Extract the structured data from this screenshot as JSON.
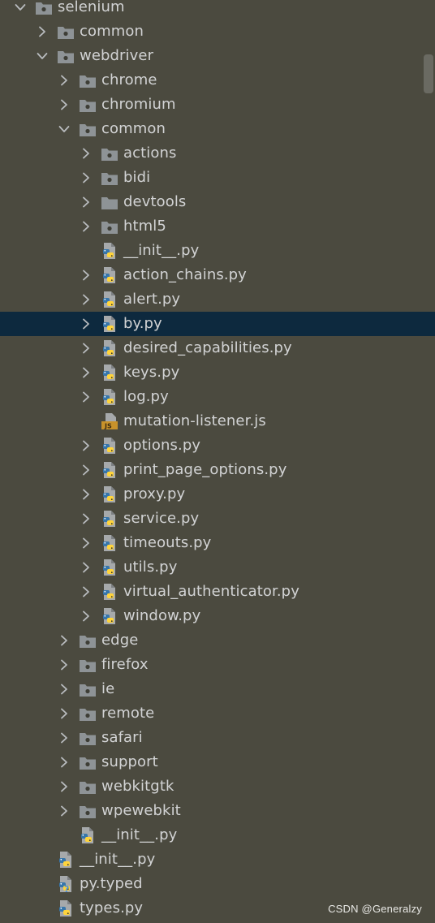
{
  "colors": {
    "background": "#4b4a3f",
    "selected_row": "#0d293e",
    "folder_icon": "#8e9396",
    "text": "#d2d3d4"
  },
  "tree": [
    {
      "label": "selenium",
      "depth": 0,
      "kind": "package",
      "arrow": "down"
    },
    {
      "label": "common",
      "depth": 1,
      "kind": "package",
      "arrow": "right"
    },
    {
      "label": "webdriver",
      "depth": 1,
      "kind": "package",
      "arrow": "down"
    },
    {
      "label": "chrome",
      "depth": 2,
      "kind": "package",
      "arrow": "right"
    },
    {
      "label": "chromium",
      "depth": 2,
      "kind": "package",
      "arrow": "right"
    },
    {
      "label": "common",
      "depth": 2,
      "kind": "package",
      "arrow": "down"
    },
    {
      "label": "actions",
      "depth": 3,
      "kind": "package",
      "arrow": "right"
    },
    {
      "label": "bidi",
      "depth": 3,
      "kind": "package",
      "arrow": "right"
    },
    {
      "label": "devtools",
      "depth": 3,
      "kind": "folder",
      "arrow": "right"
    },
    {
      "label": "html5",
      "depth": 3,
      "kind": "package",
      "arrow": "right"
    },
    {
      "label": "__init__.py",
      "depth": 3,
      "kind": "python",
      "arrow": "none"
    },
    {
      "label": "action_chains.py",
      "depth": 3,
      "kind": "python",
      "arrow": "right"
    },
    {
      "label": "alert.py",
      "depth": 3,
      "kind": "python",
      "arrow": "right"
    },
    {
      "label": "by.py",
      "depth": 3,
      "kind": "python",
      "arrow": "right",
      "selected": true
    },
    {
      "label": "desired_capabilities.py",
      "depth": 3,
      "kind": "python",
      "arrow": "right"
    },
    {
      "label": "keys.py",
      "depth": 3,
      "kind": "python",
      "arrow": "right"
    },
    {
      "label": "log.py",
      "depth": 3,
      "kind": "python",
      "arrow": "right"
    },
    {
      "label": "mutation-listener.js",
      "depth": 3,
      "kind": "js",
      "arrow": "none"
    },
    {
      "label": "options.py",
      "depth": 3,
      "kind": "python",
      "arrow": "right"
    },
    {
      "label": "print_page_options.py",
      "depth": 3,
      "kind": "python",
      "arrow": "right"
    },
    {
      "label": "proxy.py",
      "depth": 3,
      "kind": "python",
      "arrow": "right"
    },
    {
      "label": "service.py",
      "depth": 3,
      "kind": "python",
      "arrow": "right"
    },
    {
      "label": "timeouts.py",
      "depth": 3,
      "kind": "python",
      "arrow": "right"
    },
    {
      "label": "utils.py",
      "depth": 3,
      "kind": "python",
      "arrow": "right"
    },
    {
      "label": "virtual_authenticator.py",
      "depth": 3,
      "kind": "python",
      "arrow": "right"
    },
    {
      "label": "window.py",
      "depth": 3,
      "kind": "python",
      "arrow": "right"
    },
    {
      "label": "edge",
      "depth": 2,
      "kind": "package",
      "arrow": "right"
    },
    {
      "label": "firefox",
      "depth": 2,
      "kind": "package",
      "arrow": "right"
    },
    {
      "label": "ie",
      "depth": 2,
      "kind": "package",
      "arrow": "right"
    },
    {
      "label": "remote",
      "depth": 2,
      "kind": "package",
      "arrow": "right"
    },
    {
      "label": "safari",
      "depth": 2,
      "kind": "package",
      "arrow": "right"
    },
    {
      "label": "support",
      "depth": 2,
      "kind": "package",
      "arrow": "right"
    },
    {
      "label": "webkitgtk",
      "depth": 2,
      "kind": "package",
      "arrow": "right"
    },
    {
      "label": "wpewebkit",
      "depth": 2,
      "kind": "package",
      "arrow": "right"
    },
    {
      "label": "__init__.py",
      "depth": 2,
      "kind": "python",
      "arrow": "none"
    },
    {
      "label": "__init__.py",
      "depth": 1,
      "kind": "python",
      "arrow": "none"
    },
    {
      "label": "py.typed",
      "depth": 1,
      "kind": "typed",
      "arrow": "none"
    },
    {
      "label": "types.py",
      "depth": 1,
      "kind": "python",
      "arrow": "none"
    }
  ],
  "watermark": "CSDN @Generalzy"
}
